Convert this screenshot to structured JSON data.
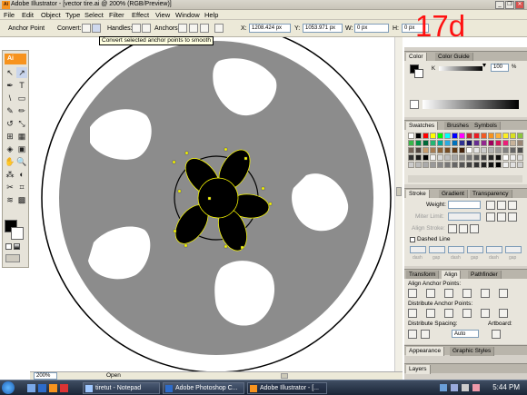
{
  "window": {
    "title": "Adobe Illustrator - [vector tire.ai @ 200% (RGB/Preview)]",
    "app_icon": "Ai",
    "minimize": "_",
    "restore": "❐",
    "close": "✕"
  },
  "menu": [
    "File",
    "Edit",
    "Object",
    "Type",
    "Select",
    "Filter",
    "Effect",
    "View",
    "Window",
    "Help"
  ],
  "control_bar": {
    "tool": "Anchor Point",
    "convert_label": "Convert:",
    "handles_label": "Handles:",
    "anchors_label": "Anchors:",
    "x_label": "X:",
    "x_value": "1208.424 px",
    "y_label": "Y:",
    "y_value": "1053.971 px",
    "w_label": "W:",
    "w_value": "0 px",
    "h_label": "H:",
    "h_value": "0 px",
    "tooltip": "Convert selected anchor points to smooth"
  },
  "annotation": {
    "step": "17d",
    "color": "#ff1111"
  },
  "tools": {
    "logo": "Ai",
    "glyphs": [
      "↖",
      "↗",
      "✒",
      "T",
      "\\",
      "▭",
      "✎",
      "✏",
      "↺",
      "⤡",
      "⊞",
      "▦",
      "◈",
      "▣",
      "✋",
      "🔍"
    ],
    "icon_names": [
      "selection-tool-icon",
      "direct-selection-tool-icon",
      "pen-tool-icon",
      "type-tool-icon",
      "line-tool-icon",
      "rectangle-tool-icon",
      "paintbrush-tool-icon",
      "pencil-tool-icon",
      "rotate-tool-icon",
      "scale-tool-icon",
      "mesh-tool-icon",
      "graph-tool-icon",
      "gradient-tool-icon",
      "symbol-tool-icon",
      "hand-tool-icon",
      "zoom-tool-icon"
    ]
  },
  "canvas": {
    "tire_color": "#8c8c8c",
    "hole_color": "#ffffff",
    "hub_color": "#000000",
    "selection_color": "#ffff00"
  },
  "status": {
    "zoom": "200%",
    "mode": "Open"
  },
  "panels": {
    "color_tabs": [
      "Color",
      "Color Guide"
    ],
    "opacity": "100",
    "opacity_unit": "%",
    "swatch_tabs": [
      "Swatches",
      "Brushes",
      "Symbols"
    ],
    "stroke_tabs": [
      "Stroke",
      "Gradient",
      "Transparency"
    ],
    "weight_label": "Weight:",
    "miter_label": "Miter Limit:",
    "align_stroke_label": "Align Stroke:",
    "dashed_line": "Dashed Line",
    "dash_labels": [
      "dash",
      "gap",
      "dash",
      "gap",
      "dash",
      "gap"
    ],
    "transform_tabs": [
      "Transform",
      "Align",
      "Pathfinder"
    ],
    "align_anchor": "Align Anchor Points:",
    "distribute_anchor": "Distribute Anchor Points:",
    "distribute_spacing": "Distribute Spacing:",
    "artboard": "Artboard:",
    "spacing_value": "Auto",
    "appearance_tabs": [
      "Appearance",
      "Graphic Styles"
    ],
    "layers_tab": "Layers"
  },
  "taskbar": {
    "tasks": [
      {
        "label": "tiretut - Notepad",
        "icon_color": "#9fc7ff"
      },
      {
        "label": "Adobe Photoshop C...",
        "icon_color": "#2d6bc9"
      },
      {
        "label": "Adobe Illustrator - [...",
        "icon_color": "#f7931e"
      }
    ],
    "clock": "5:44 PM"
  }
}
